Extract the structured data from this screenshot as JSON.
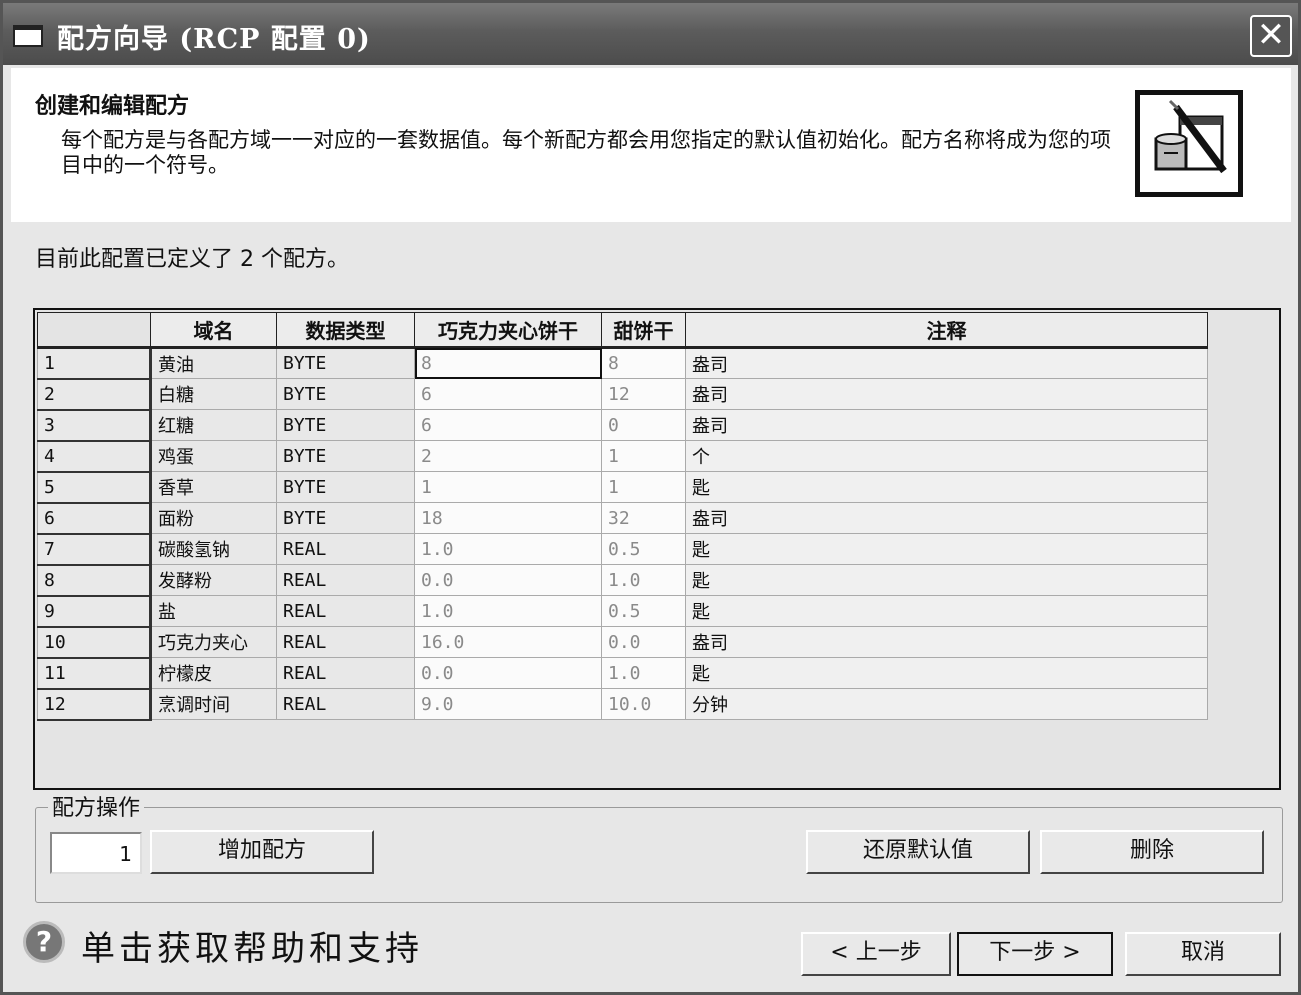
{
  "window": {
    "title": "配方向导 (RCP 配置 0)",
    "close": "✕"
  },
  "header": {
    "title": "创建和编辑配方",
    "description": "每个配方是与各配方域一一对应的一套数据值。每个新配方都会用您指定的默认值初始化。配方名称将成为您的项目中的一个符号。"
  },
  "info": "目前此配置已定义了 2 个配方。",
  "table": {
    "columns": [
      "",
      "域名",
      "数据类型",
      "巧克力夹心饼干",
      "甜饼干",
      "注释"
    ],
    "rows": [
      [
        "1",
        "黄油",
        "BYTE",
        "8",
        "8",
        "盎司"
      ],
      [
        "2",
        "白糖",
        "BYTE",
        "6",
        "12",
        "盎司"
      ],
      [
        "3",
        "红糖",
        "BYTE",
        "6",
        "0",
        "盎司"
      ],
      [
        "4",
        "鸡蛋",
        "BYTE",
        "2",
        "1",
        "个"
      ],
      [
        "5",
        "香草",
        "BYTE",
        "1",
        "1",
        "匙"
      ],
      [
        "6",
        "面粉",
        "BYTE",
        "18",
        "32",
        "盎司"
      ],
      [
        "7",
        "碳酸氢钠",
        "REAL",
        "1.0",
        "0.5",
        "匙"
      ],
      [
        "8",
        "发酵粉",
        "REAL",
        "0.0",
        "1.0",
        "匙"
      ],
      [
        "9",
        "盐",
        "REAL",
        "1.0",
        "0.5",
        "匙"
      ],
      [
        "10",
        "巧克力夹心",
        "REAL",
        "16.0",
        "0.0",
        "盎司"
      ],
      [
        "11",
        "柠檬皮",
        "REAL",
        "0.0",
        "1.0",
        "匙"
      ],
      [
        "12",
        "烹调时间",
        "REAL",
        "9.0",
        "10.0",
        "分钟"
      ]
    ]
  },
  "operations": {
    "title": "配方操作",
    "count_value": "1",
    "add": "增加配方",
    "restore": "还原默认值",
    "delete": "删除"
  },
  "help": {
    "icon": "?",
    "text": "单击获取帮助和支持"
  },
  "nav": {
    "prev": "< 上一步",
    "next": "下一步 >",
    "cancel": "取消"
  }
}
